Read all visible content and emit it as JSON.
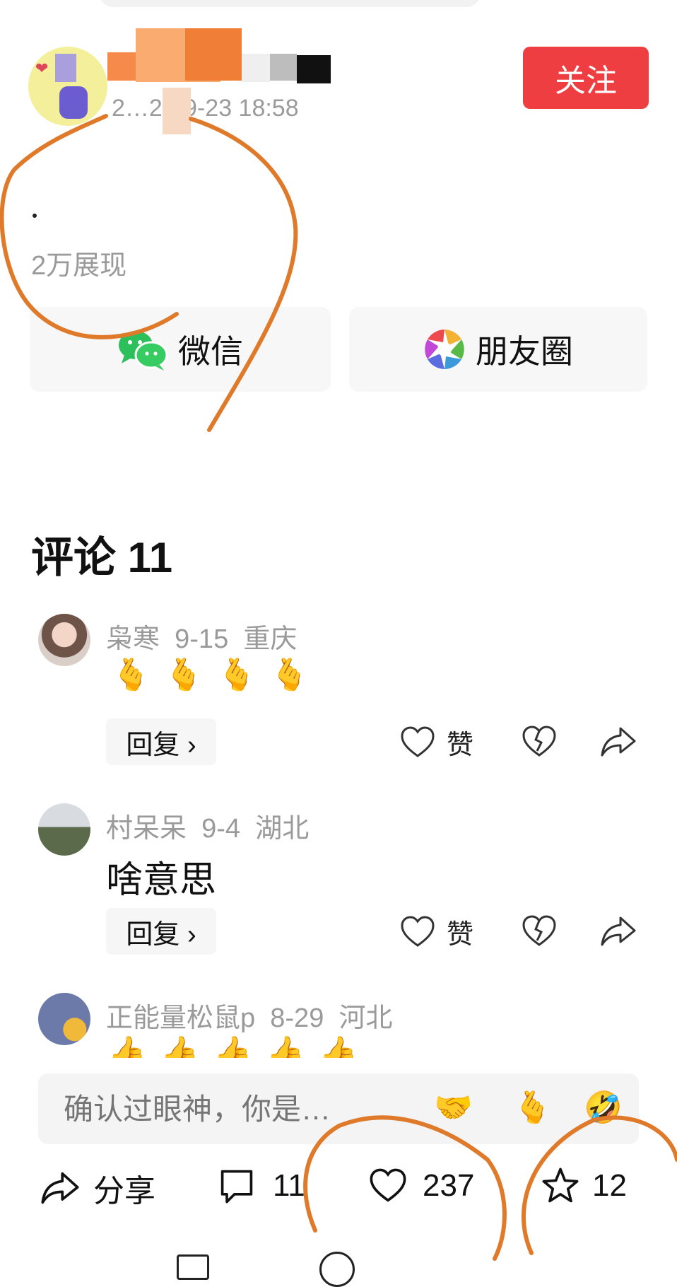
{
  "post": {
    "timestamp": "2…21-9-23 18:58",
    "follow_label": "关注",
    "body_text": "·",
    "views": "2万展现"
  },
  "share": {
    "wechat_label": "微信",
    "moments_label": "朋友圈"
  },
  "comments": {
    "title": "评论 11",
    "like_label": "赞",
    "reply_label": "回复 ›",
    "items": [
      {
        "user": "枭寒",
        "date": "9-15",
        "region": "重庆",
        "content": "🫰🫰🫰🫰"
      },
      {
        "user": "村呆呆",
        "date": "9-4",
        "region": "湖北",
        "content": "啥意思"
      },
      {
        "user": "正能量松鼠p",
        "date": "8-29",
        "region": "河北",
        "content": "👍👍👍👍👍"
      }
    ]
  },
  "input": {
    "placeholder": "确认过眼神，你是…",
    "emojis": [
      "🤝",
      "🫰",
      "🤣"
    ]
  },
  "bottom_bar": {
    "share_label": "分享",
    "comment_count": "11",
    "like_count": "237",
    "favorite_count": "12"
  },
  "colors": {
    "accent": "#ef3e41",
    "annotation": "#e07a2b",
    "muted_text": "#9a9a9a"
  },
  "icons": [
    "wechat-icon",
    "moments-icon",
    "heart-icon",
    "broken-heart-icon",
    "forward-icon",
    "share-icon",
    "comment-icon",
    "star-icon"
  ]
}
